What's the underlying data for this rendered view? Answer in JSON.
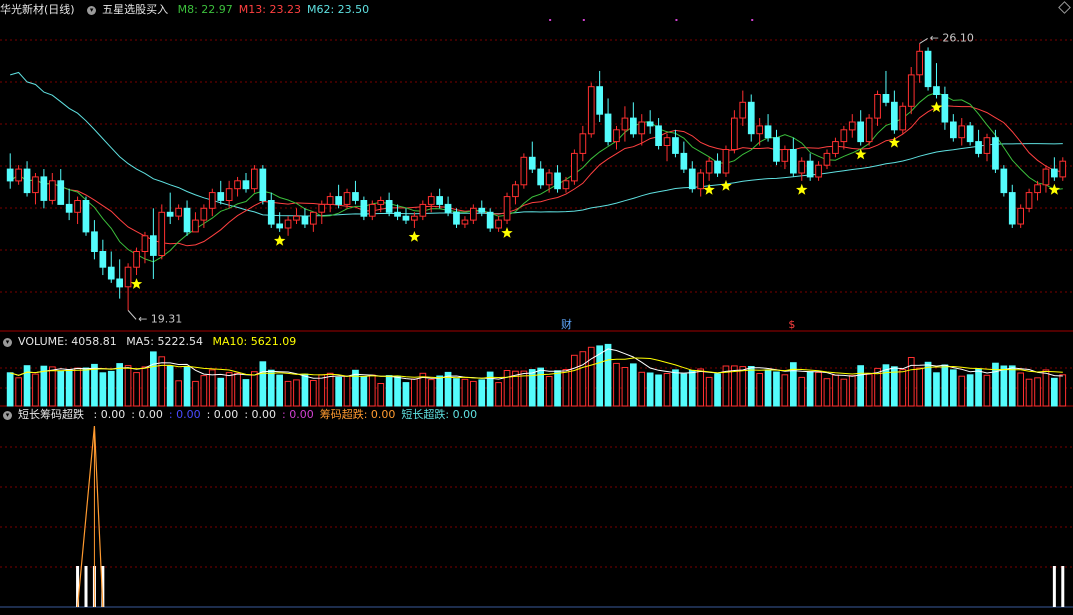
{
  "main_panel": {
    "stock_title": "华光新材(日线)",
    "indicator_name": "五星选股买入",
    "ma_labels": [
      {
        "text": "M8: 22.97",
        "color": "#3cbf3c"
      },
      {
        "text": "M13: 23.23",
        "color": "#ff4040"
      },
      {
        "text": "M62: 23.50",
        "color": "#5fe0e0"
      }
    ],
    "high_label": "26.10",
    "low_label": "19.31",
    "event_labels": [
      {
        "text": "财",
        "color": "#5fa8ff"
      },
      {
        "text": "$",
        "color": "#ff4040"
      }
    ]
  },
  "volume_panel": {
    "title": "VOLUME: 4058.81",
    "ma5_label": "MA5: 5222.54",
    "ma10_label": "MA10: 5621.09"
  },
  "indicator_panel": {
    "name": "短长筹码超跌",
    "segments": [
      {
        "text": ": 0.00",
        "color": "#e6e6e6"
      },
      {
        "text": ": 0.00",
        "color": "#e6e6e6"
      },
      {
        "text": ": 0.00",
        "color": "#4a4aff"
      },
      {
        "text": ": 0.00",
        "color": "#e6e6e6"
      },
      {
        "text": ": 0.00",
        "color": "#e6e6e6"
      },
      {
        "text": ": 0.00",
        "color": "#d040d0"
      },
      {
        "text": "筹码超跌: 0.00",
        "color": "#ff9a30"
      },
      {
        "text": "短长超跌: 0.00",
        "color": "#5fe0e0"
      }
    ]
  },
  "colors": {
    "up": "#ff3030",
    "down": "#54fcfc",
    "ma8": "#3cbf3c",
    "ma13": "#ff4040",
    "ma62": "#5fe0e0",
    "star": "#ffff00",
    "vol_ma5": "#ffffff",
    "vol_ma10": "#ffff00",
    "grid": "#7a0000"
  },
  "chart_data": {
    "type": "candlestick",
    "title": "华光新材(日线)",
    "ylim": [
      18.8,
      26.8
    ],
    "candles_ohlc": [
      [
        22.9,
        23.3,
        22.4,
        22.6
      ],
      [
        22.6,
        23.0,
        22.5,
        22.9
      ],
      [
        22.9,
        23.1,
        22.2,
        22.3
      ],
      [
        22.3,
        22.8,
        22.0,
        22.7
      ],
      [
        22.7,
        22.9,
        21.9,
        22.1
      ],
      [
        22.1,
        22.8,
        22.0,
        22.6
      ],
      [
        22.6,
        22.9,
        22.0,
        22.0
      ],
      [
        22.0,
        22.4,
        21.6,
        21.8
      ],
      [
        21.8,
        22.2,
        21.5,
        22.1
      ],
      [
        22.1,
        22.2,
        21.2,
        21.3
      ],
      [
        21.3,
        21.6,
        20.6,
        20.8
      ],
      [
        20.8,
        21.1,
        20.2,
        20.4
      ],
      [
        20.4,
        20.8,
        20.0,
        20.1
      ],
      [
        20.1,
        20.6,
        19.6,
        19.9
      ],
      [
        19.9,
        20.5,
        19.3,
        20.4
      ],
      [
        20.4,
        20.9,
        20.2,
        20.8
      ],
      [
        20.8,
        21.3,
        20.5,
        21.2
      ],
      [
        21.2,
        21.9,
        20.1,
        20.7
      ],
      [
        20.7,
        22.0,
        20.6,
        21.8
      ],
      [
        21.8,
        22.3,
        21.5,
        21.7
      ],
      [
        21.7,
        22.0,
        21.6,
        21.9
      ],
      [
        21.9,
        22.1,
        21.2,
        21.3
      ],
      [
        21.3,
        21.8,
        21.3,
        21.6
      ],
      [
        21.6,
        22.0,
        21.4,
        21.9
      ],
      [
        21.9,
        22.4,
        21.7,
        22.3
      ],
      [
        22.3,
        22.6,
        22.0,
        22.1
      ],
      [
        22.1,
        22.6,
        21.9,
        22.4
      ],
      [
        22.4,
        22.7,
        22.2,
        22.6
      ],
      [
        22.6,
        22.8,
        22.3,
        22.4
      ],
      [
        22.4,
        23.0,
        22.3,
        22.9
      ],
      [
        22.9,
        23.0,
        22.0,
        22.1
      ],
      [
        22.1,
        22.3,
        21.4,
        21.5
      ],
      [
        21.5,
        21.8,
        21.3,
        21.4
      ],
      [
        21.4,
        21.7,
        21.2,
        21.6
      ],
      [
        21.6,
        21.9,
        21.5,
        21.7
      ],
      [
        21.7,
        21.9,
        21.4,
        21.5
      ],
      [
        21.5,
        21.8,
        21.3,
        21.8
      ],
      [
        21.8,
        22.1,
        21.5,
        22.0
      ],
      [
        22.0,
        22.3,
        21.8,
        22.2
      ],
      [
        22.2,
        22.5,
        21.9,
        22.0
      ],
      [
        22.0,
        22.4,
        21.9,
        22.3
      ],
      [
        22.3,
        22.6,
        22.0,
        22.1
      ],
      [
        22.1,
        22.2,
        21.6,
        21.7
      ],
      [
        21.7,
        22.1,
        21.6,
        22.0
      ],
      [
        22.0,
        22.2,
        21.8,
        22.1
      ],
      [
        22.1,
        22.3,
        21.7,
        21.8
      ],
      [
        21.8,
        22.0,
        21.6,
        21.7
      ],
      [
        21.7,
        21.9,
        21.5,
        21.6
      ],
      [
        21.6,
        21.8,
        21.4,
        21.7
      ],
      [
        21.7,
        22.1,
        21.6,
        22.0
      ],
      [
        22.0,
        22.3,
        21.8,
        22.2
      ],
      [
        22.2,
        22.4,
        21.9,
        22.0
      ],
      [
        22.0,
        22.2,
        21.7,
        21.8
      ],
      [
        21.8,
        21.9,
        21.4,
        21.5
      ],
      [
        21.5,
        21.7,
        21.4,
        21.6
      ],
      [
        21.6,
        22.0,
        21.5,
        21.9
      ],
      [
        21.9,
        22.1,
        21.7,
        21.8
      ],
      [
        21.8,
        21.9,
        21.3,
        21.4
      ],
      [
        21.4,
        21.7,
        21.3,
        21.6
      ],
      [
        21.6,
        22.3,
        21.5,
        22.2
      ],
      [
        22.2,
        22.6,
        22.0,
        22.5
      ],
      [
        22.5,
        23.3,
        22.4,
        23.2
      ],
      [
        23.2,
        23.6,
        22.8,
        22.9
      ],
      [
        22.9,
        23.1,
        22.4,
        22.5
      ],
      [
        22.5,
        22.9,
        22.3,
        22.8
      ],
      [
        22.8,
        23.0,
        22.3,
        22.4
      ],
      [
        22.4,
        22.7,
        22.3,
        22.6
      ],
      [
        22.6,
        23.4,
        22.5,
        23.3
      ],
      [
        23.3,
        24.0,
        23.1,
        23.8
      ],
      [
        23.8,
        25.1,
        23.7,
        25.0
      ],
      [
        25.0,
        25.4,
        24.1,
        24.3
      ],
      [
        24.3,
        24.7,
        23.5,
        23.6
      ],
      [
        23.6,
        24.0,
        23.4,
        23.9
      ],
      [
        23.9,
        24.5,
        23.6,
        24.2
      ],
      [
        24.2,
        24.6,
        23.7,
        23.8
      ],
      [
        23.8,
        24.3,
        23.5,
        24.1
      ],
      [
        24.1,
        24.4,
        23.8,
        24.0
      ],
      [
        24.0,
        24.2,
        23.4,
        23.5
      ],
      [
        23.5,
        23.8,
        23.1,
        23.7
      ],
      [
        23.7,
        23.9,
        23.2,
        23.3
      ],
      [
        23.3,
        23.6,
        22.8,
        22.9
      ],
      [
        22.9,
        23.1,
        22.3,
        22.4
      ],
      [
        22.4,
        22.9,
        22.2,
        22.8
      ],
      [
        22.8,
        23.2,
        22.6,
        23.1
      ],
      [
        23.1,
        23.3,
        22.7,
        22.8
      ],
      [
        22.8,
        23.5,
        22.7,
        23.4
      ],
      [
        23.4,
        24.4,
        23.3,
        24.2
      ],
      [
        24.2,
        24.9,
        24.0,
        24.6
      ],
      [
        24.6,
        24.8,
        23.6,
        23.8
      ],
      [
        23.8,
        24.2,
        23.5,
        24.0
      ],
      [
        24.0,
        24.3,
        23.6,
        23.7
      ],
      [
        23.7,
        23.9,
        23.0,
        23.1
      ],
      [
        23.1,
        23.5,
        22.9,
        23.4
      ],
      [
        23.4,
        23.7,
        22.7,
        22.8
      ],
      [
        22.8,
        23.2,
        22.6,
        23.1
      ],
      [
        23.1,
        23.3,
        22.6,
        22.7
      ],
      [
        22.7,
        23.1,
        22.6,
        23.0
      ],
      [
        23.0,
        23.4,
        22.9,
        23.3
      ],
      [
        23.3,
        23.7,
        23.2,
        23.6
      ],
      [
        23.6,
        24.0,
        23.4,
        23.9
      ],
      [
        23.9,
        24.3,
        23.7,
        24.1
      ],
      [
        24.1,
        24.4,
        23.5,
        23.6
      ],
      [
        23.6,
        24.3,
        23.5,
        24.2
      ],
      [
        24.2,
        24.9,
        24.0,
        24.8
      ],
      [
        24.8,
        25.4,
        24.5,
        24.6
      ],
      [
        24.6,
        24.9,
        23.8,
        23.9
      ],
      [
        23.9,
        24.6,
        23.8,
        24.5
      ],
      [
        24.5,
        25.5,
        24.3,
        25.3
      ],
      [
        25.3,
        26.1,
        25.1,
        25.9
      ],
      [
        25.9,
        26.0,
        24.9,
        25.0
      ],
      [
        25.0,
        25.6,
        24.7,
        24.8
      ],
      [
        24.8,
        25.0,
        23.9,
        24.1
      ],
      [
        24.1,
        24.3,
        23.6,
        23.7
      ],
      [
        23.7,
        24.2,
        23.5,
        24.0
      ],
      [
        24.0,
        24.1,
        23.5,
        23.6
      ],
      [
        23.6,
        23.9,
        23.2,
        23.3
      ],
      [
        23.3,
        23.8,
        23.1,
        23.7
      ],
      [
        23.7,
        23.9,
        22.8,
        22.9
      ],
      [
        22.9,
        23.0,
        22.2,
        22.3
      ],
      [
        22.3,
        22.5,
        21.4,
        21.5
      ],
      [
        21.5,
        22.0,
        21.4,
        21.9
      ],
      [
        21.9,
        22.4,
        21.8,
        22.3
      ],
      [
        22.3,
        22.6,
        22.1,
        22.5
      ],
      [
        22.5,
        23.0,
        22.3,
        22.9
      ],
      [
        22.9,
        23.2,
        22.6,
        22.7
      ],
      [
        22.7,
        23.2,
        22.6,
        23.1
      ]
    ],
    "star_indices": [
      15,
      32,
      48,
      59,
      83,
      85,
      94,
      101,
      105,
      110,
      124
    ],
    "volume_ylim": [
      0,
      10000
    ],
    "indicator_spike_indices": [
      8,
      9,
      10,
      11,
      124,
      125
    ],
    "indicator_peak_index": 10
  }
}
